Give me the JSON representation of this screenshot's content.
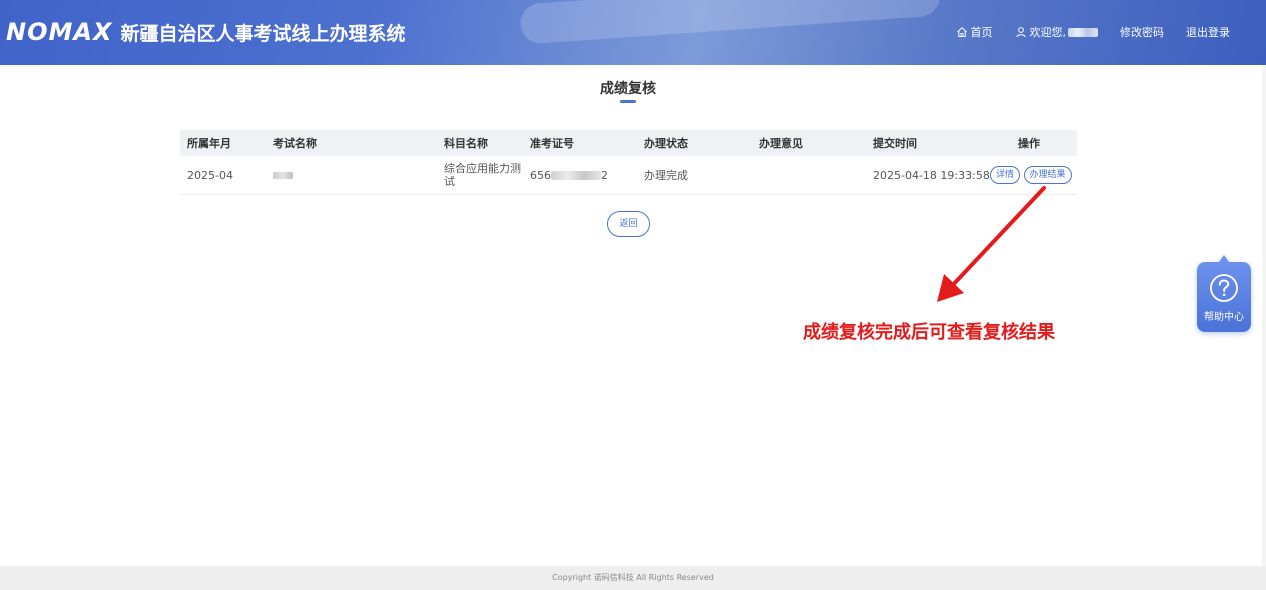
{
  "header": {
    "logo": "NOMAX",
    "system_title": "新疆自治区人事考试线上办理系统",
    "nav": {
      "home": "首页",
      "welcome": "欢迎您,",
      "change_password": "修改密码",
      "logout": "退出登录"
    }
  },
  "page": {
    "title": "成绩复核"
  },
  "table": {
    "columns": [
      "所属年月",
      "考试名称",
      "科目名称",
      "准考证号",
      "办理状态",
      "办理意见",
      "提交时间",
      "操作"
    ],
    "rows": [
      {
        "year_month": "2025-04",
        "exam_name": "",
        "subject_line1": "综合应用能力测",
        "subject_line2": "试",
        "ticket_prefix": "656",
        "ticket_suffix": "2",
        "status": "办理完成",
        "opinion": "",
        "submit_time": "2025-04-18 19:33:58",
        "action_detail": "详情",
        "action_result": "办理结果"
      }
    ]
  },
  "back_button": "返回",
  "annotation": "成绩复核完成后可查看复核结果",
  "help": {
    "label": "帮助中心"
  },
  "footer": {
    "copyright": "Copyright 诺码信科技 All Rights Reserved"
  },
  "colors": {
    "accent": "#4a72d8",
    "annotation": "#e31b1b",
    "header": "#4a6dcc"
  },
  "icons": [
    "home-icon",
    "user-icon",
    "question-icon",
    "arrow-icon"
  ]
}
